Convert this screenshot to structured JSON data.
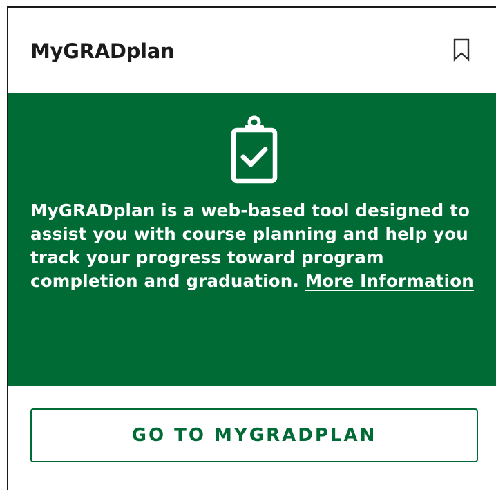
{
  "card": {
    "title": "MyGRADplan",
    "bookmark_icon": "bookmark-icon",
    "body": {
      "icon": "clipboard-check-icon",
      "description": "MyGRADplan is a web-based tool designed to assist you with course planning and help you track your progress toward program completion and graduation. ",
      "link_text": "More Information"
    },
    "button_label": "GO TO MYGRADPLAN"
  },
  "colors": {
    "brand_green": "#006b35",
    "text_dark": "#1b1b1b",
    "white": "#ffffff"
  }
}
